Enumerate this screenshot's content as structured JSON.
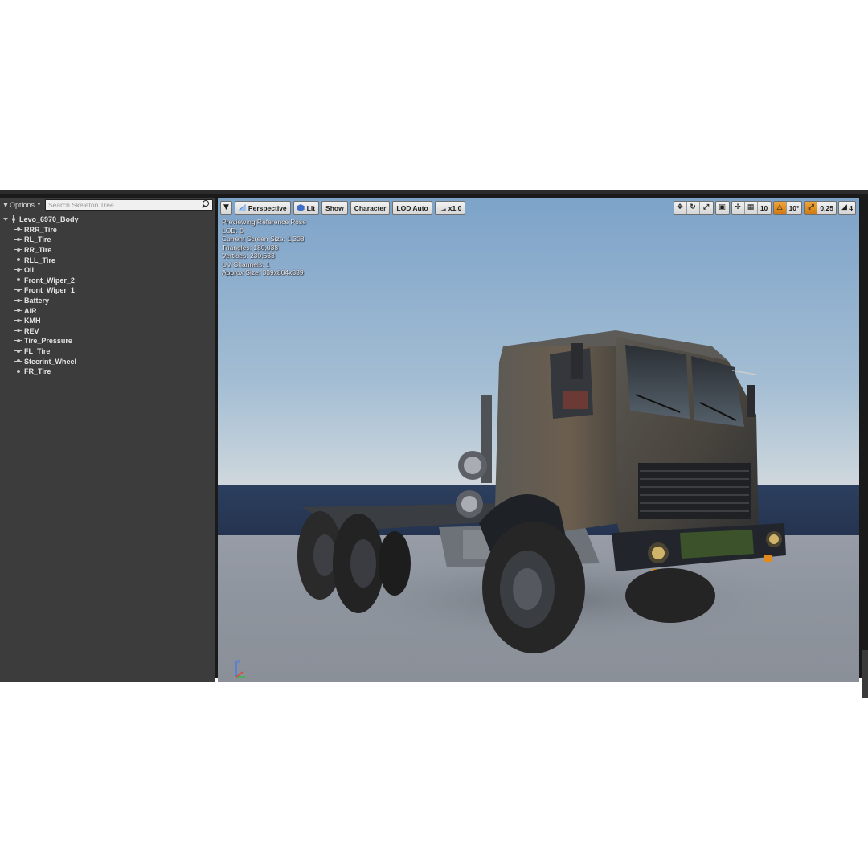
{
  "skeleton_panel": {
    "options_label": "Options",
    "search_placeholder": "Search Skeleton Tree...",
    "root_bone": "Levo_6970_Body",
    "bones": [
      "RRR_Tire",
      "RL_Tire",
      "RR_Tire",
      "RLL_Tire",
      "OIL",
      "Front_Wiper_2",
      "Front_Wiper_1",
      "Battery",
      "AIR",
      "KMH",
      "REV",
      "Tire_Pressure",
      "FL_Tire",
      "Steerint_Wheel",
      "FR_Tire"
    ]
  },
  "viewport_toolbar": {
    "perspective_label": "Perspective",
    "lit_label": "Lit",
    "show_label": "Show",
    "character_label": "Character",
    "lod_label": "LOD Auto",
    "speed_label": "x1,0",
    "grid_snap_value": "10",
    "rotation_snap_value": "10°",
    "scale_snap_value": "0,25",
    "camera_speed_value": "4"
  },
  "info_overlay": {
    "lines": [
      "Previewing Reference Pose",
      "LOD: 0",
      "Current Screen Size: 1,308",
      "Triangles: 180,038",
      "Vertices: 230,633",
      "UV Channels: 1",
      "Approx Size: 339x804x339"
    ]
  },
  "colors": {
    "panel_bg": "#3c3c3c",
    "active_orange": "#e39128",
    "sky_top": "#7da3c9",
    "horizon": "#24334f",
    "floor": "#8f959e"
  }
}
